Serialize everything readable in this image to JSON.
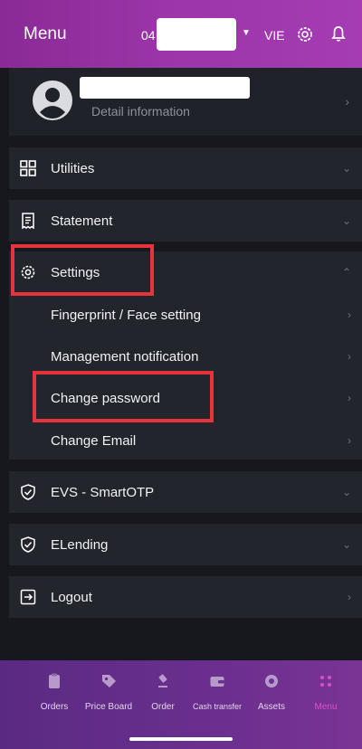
{
  "header": {
    "title": "Menu",
    "account_prefix": "04",
    "language": "VIE"
  },
  "profile": {
    "detail_label": "Detail information"
  },
  "menu": {
    "utilities": "Utilities",
    "statement": "Statement",
    "settings": "Settings",
    "settings_items": [
      "Fingerprint / Face setting",
      "Management notification",
      "Change password",
      "Change Email"
    ],
    "evs": "EVS - SmartOTP",
    "elending": "ELending",
    "logout": "Logout"
  },
  "tabs": [
    "Orders",
    "Price Board",
    "Order",
    "Cash transfer",
    "Assets",
    "Menu"
  ],
  "colors": {
    "highlight": "#e8333d",
    "active_tab": "#d651c8",
    "header": "#9b35a8"
  }
}
